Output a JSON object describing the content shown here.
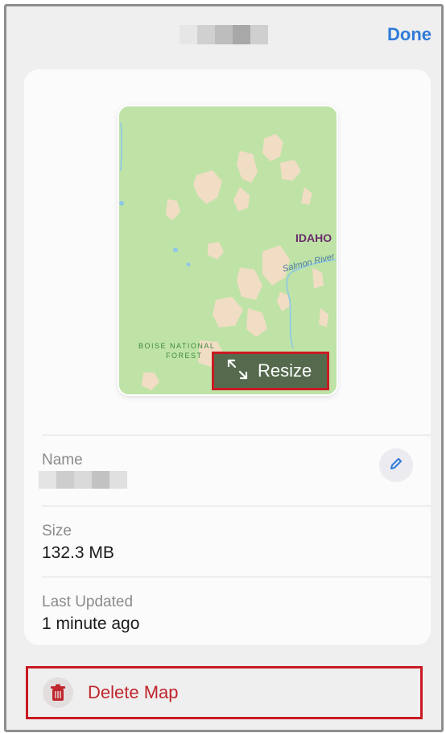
{
  "header": {
    "done_label": "Done"
  },
  "map": {
    "labels": {
      "idaho": "IDAHO",
      "river": "Salmon River",
      "forest_line1": "BOISE NATIONAL",
      "forest_line2": "FOREST"
    },
    "resize_label": "Resize"
  },
  "details": {
    "name": {
      "label": "Name"
    },
    "size": {
      "label": "Size",
      "value": "132.3 MB"
    },
    "updated": {
      "label": "Last Updated",
      "value": "1 minute ago"
    }
  },
  "actions": {
    "delete_label": "Delete Map"
  },
  "colors": {
    "accent": "#2f7bd8",
    "destructive": "#c0262d",
    "highlight": "#c91a22"
  }
}
